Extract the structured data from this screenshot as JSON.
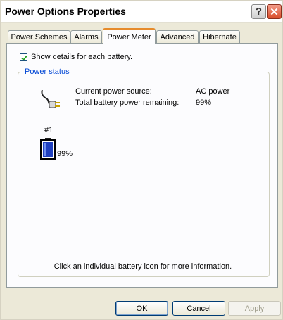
{
  "window": {
    "title": "Power Options Properties",
    "help_glyph": "?",
    "close_glyph": "✕"
  },
  "tabs": [
    {
      "label": "Power Schemes"
    },
    {
      "label": "Alarms"
    },
    {
      "label": "Power Meter"
    },
    {
      "label": "Advanced"
    },
    {
      "label": "Hibernate"
    }
  ],
  "show_details": {
    "label": "Show details for each battery.",
    "checked": true
  },
  "power_status": {
    "group_label": "Power status",
    "source_label": "Current power source:",
    "source_value": "AC power",
    "remaining_label": "Total battery power remaining:",
    "remaining_value": "99%",
    "battery": {
      "number": "#1",
      "percent": "99%"
    },
    "hint": "Click an individual battery icon for more information."
  },
  "buttons": {
    "ok": "OK",
    "cancel": "Cancel",
    "apply": "Apply"
  },
  "colors": {
    "accent": "#e68b2c",
    "group_label": "#0046d5",
    "battery_fill": "#1f3fbf"
  }
}
